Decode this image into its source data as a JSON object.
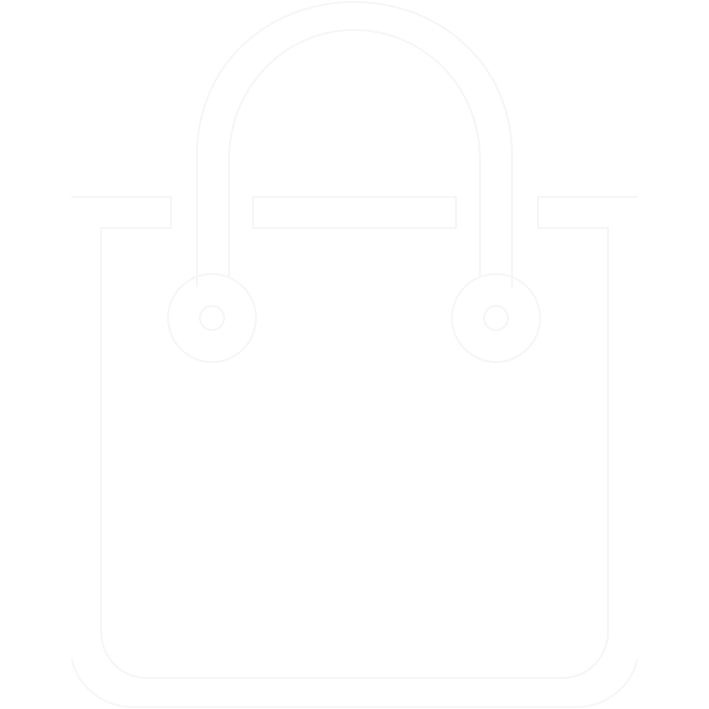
{
  "icon": {
    "name": "shopping-bag-icon",
    "background_color": "#ffffff",
    "stroke_color": "#f6f6f6"
  }
}
